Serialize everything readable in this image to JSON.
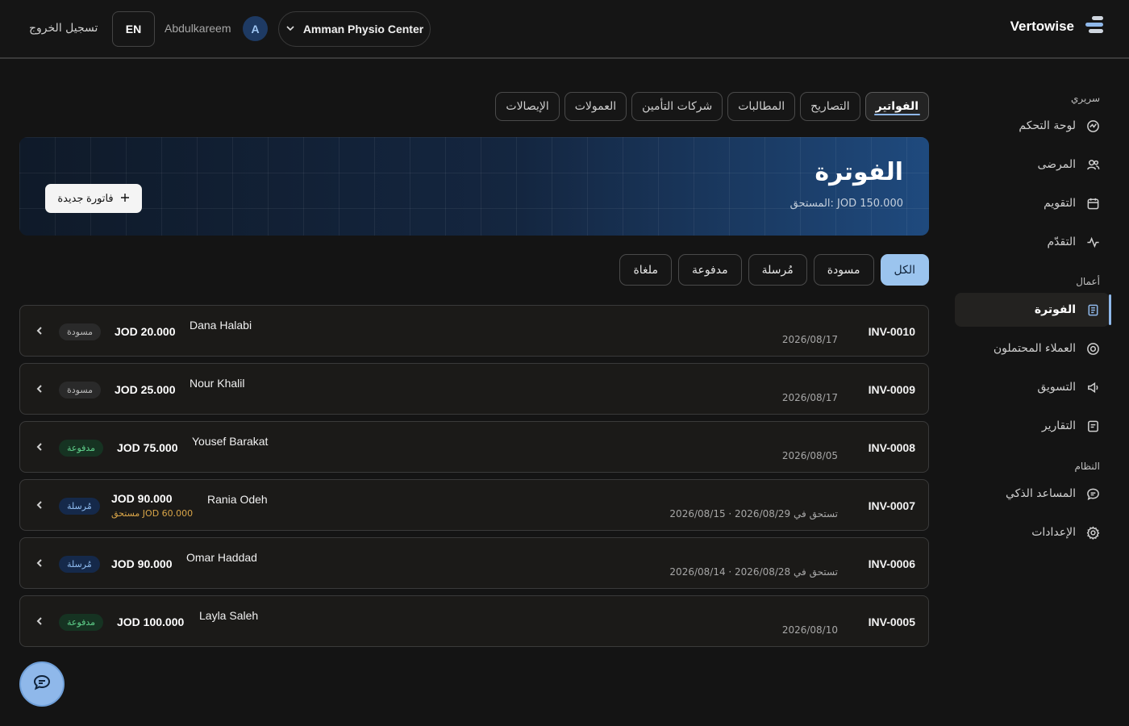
{
  "header": {
    "brand": "Vertowise",
    "clinic": "Amman Physio Center",
    "avatar_initial": "A",
    "username": "Abdulkareem",
    "lang": "EN",
    "logout": "تسجيل الخروج"
  },
  "sidebar": {
    "sections": {
      "clinical": "سريري",
      "business": "أعمال",
      "system": "النظام"
    },
    "items": [
      {
        "label": "لوحة التحكم",
        "icon": "dashboard-icon"
      },
      {
        "label": "المرضى",
        "icon": "users-icon"
      },
      {
        "label": "التقويم",
        "icon": "calendar-icon"
      },
      {
        "label": "التقدّم",
        "icon": "activity-icon"
      },
      {
        "label": "الفوترة",
        "icon": "receipt-icon"
      },
      {
        "label": "العملاء المحتملون",
        "icon": "target-icon"
      },
      {
        "label": "التسويق",
        "icon": "megaphone-icon"
      },
      {
        "label": "التقارير",
        "icon": "report-icon"
      },
      {
        "label": "المساعد الذكي",
        "icon": "chat-icon"
      },
      {
        "label": "الإعدادات",
        "icon": "gear-icon"
      }
    ]
  },
  "tabs": [
    "الفواتير",
    "التصاريح",
    "المطالبات",
    "شركات التأمين",
    "العمولات",
    "الإيصالات"
  ],
  "banner": {
    "title": "الفوترة",
    "due": "المستحق: JOD 150.000",
    "new_invoice": "فاتورة جديدة"
  },
  "filters": [
    "الكل",
    "مسودة",
    "مُرسلة",
    "مدفوعة",
    "ملغاة"
  ],
  "invoices": [
    {
      "number": "INV-0010",
      "date": "2026/08/17",
      "patient": "Dana Halabi",
      "amount": "JOD 20.000",
      "status": "مسودة",
      "status_type": "draft"
    },
    {
      "number": "INV-0009",
      "date": "2026/08/17",
      "patient": "Nour Khalil",
      "amount": "JOD 25.000",
      "status": "مسودة",
      "status_type": "draft"
    },
    {
      "number": "INV-0008",
      "date": "2026/08/05",
      "patient": "Yousef Barakat",
      "amount": "JOD 75.000",
      "status": "مدفوعة",
      "status_type": "paid"
    },
    {
      "number": "INV-0007",
      "date": "2026/08/15 · تستحق في 2026/08/29",
      "patient": "Rania Odeh",
      "amount": "JOD 90.000",
      "amount_due": "مستحق JOD 60.000",
      "status": "مُرسلة",
      "status_type": "sent"
    },
    {
      "number": "INV-0006",
      "date": "2026/08/14 · تستحق في 2026/08/28",
      "patient": "Omar Haddad",
      "amount": "JOD 90.000",
      "status": "مُرسلة",
      "status_type": "sent"
    },
    {
      "number": "INV-0005",
      "date": "2026/08/10",
      "patient": "Layla Saleh",
      "amount": "JOD 100.000",
      "status": "مدفوعة",
      "status_type": "paid"
    }
  ],
  "colors": {
    "accent": "#8fb8ea",
    "paid": "#5fcf8a",
    "sent": "#8fbcf0",
    "due_warning": "#d9a548"
  }
}
